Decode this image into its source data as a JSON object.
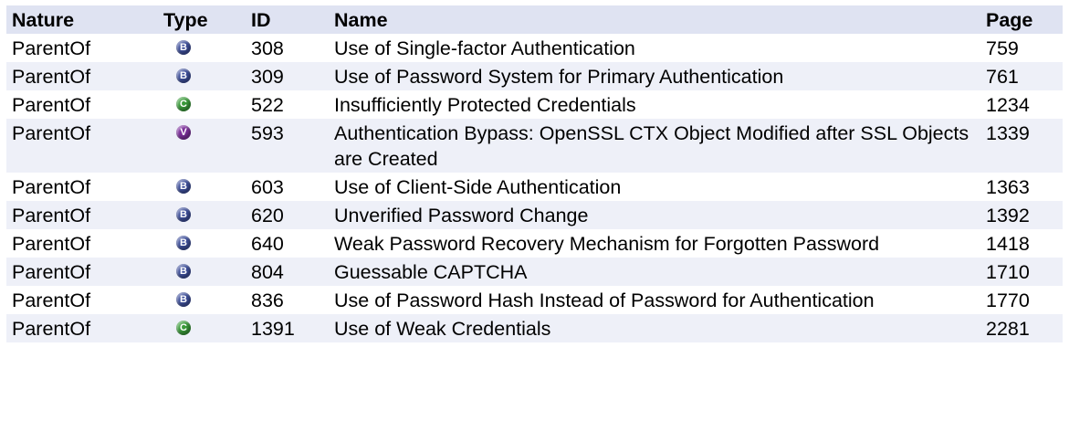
{
  "table": {
    "headers": {
      "nature": "Nature",
      "type": "Type",
      "id": "ID",
      "name": "Name",
      "page": "Page"
    },
    "type_colors": {
      "B": "#3e4f9a",
      "C": "#3a9a3a",
      "V": "#7b2f9a"
    },
    "rows": [
      {
        "nature": "ParentOf",
        "type": "B",
        "type_icon": "base-weakness-icon",
        "id": "308",
        "name": "Use of Single-factor Authentication",
        "page": "759"
      },
      {
        "nature": "ParentOf",
        "type": "B",
        "type_icon": "base-weakness-icon",
        "id": "309",
        "name": "Use of Password System for Primary Authentication",
        "page": "761"
      },
      {
        "nature": "ParentOf",
        "type": "C",
        "type_icon": "class-weakness-icon",
        "id": "522",
        "name": "Insufficiently Protected Credentials",
        "page": "1234"
      },
      {
        "nature": "ParentOf",
        "type": "V",
        "type_icon": "variant-weakness-icon",
        "id": "593",
        "name": "Authentication Bypass: OpenSSL CTX Object Modified after SSL Objects are Created",
        "page": "1339"
      },
      {
        "nature": "ParentOf",
        "type": "B",
        "type_icon": "base-weakness-icon",
        "id": "603",
        "name": "Use of Client-Side Authentication",
        "page": "1363"
      },
      {
        "nature": "ParentOf",
        "type": "B",
        "type_icon": "base-weakness-icon",
        "id": "620",
        "name": "Unverified Password Change",
        "page": "1392"
      },
      {
        "nature": "ParentOf",
        "type": "B",
        "type_icon": "base-weakness-icon",
        "id": "640",
        "name": "Weak Password Recovery Mechanism for Forgotten Password",
        "page": "1418"
      },
      {
        "nature": "ParentOf",
        "type": "B",
        "type_icon": "base-weakness-icon",
        "id": "804",
        "name": "Guessable CAPTCHA",
        "page": "1710"
      },
      {
        "nature": "ParentOf",
        "type": "B",
        "type_icon": "base-weakness-icon",
        "id": "836",
        "name": "Use of Password Hash Instead of Password for Authentication",
        "page": "1770"
      },
      {
        "nature": "ParentOf",
        "type": "C",
        "type_icon": "class-weakness-icon",
        "id": "1391",
        "name": "Use of Weak Credentials",
        "page": "2281"
      }
    ]
  }
}
